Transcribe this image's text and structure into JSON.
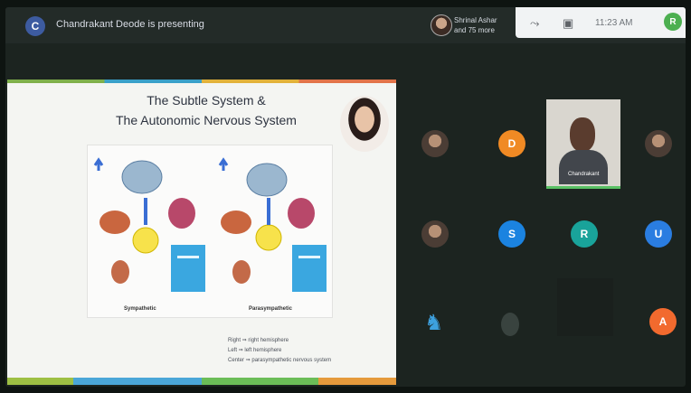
{
  "topbar": {
    "presenter_initial": "C",
    "presenting_text": "Chandrakant Deode is presenting",
    "people_line1": "Shrinal Ashar",
    "people_line2": "and 75 more"
  },
  "status": {
    "clock": "11:23 AM",
    "account_initial": "R"
  },
  "slide": {
    "title_line1": "The Subtle System &",
    "title_line2": "The Autonomic Nervous System",
    "caption_left": "Sympathetic",
    "caption_right": "Parasympathetic",
    "notes": [
      "Right ⇒ right hemisphere",
      "Left ⇒ left hemisphere",
      "Center ⇒ parasympathetic nervous system"
    ]
  },
  "participants": {
    "d": "D",
    "s": "S",
    "r": "R",
    "u": "U",
    "a": "A",
    "video_label": "Chandrakant"
  },
  "colors": {
    "d": "#f08a24",
    "s": "#1b83e0",
    "r": "#19a39a",
    "u": "#2a7de1",
    "a": "#f26a2e"
  }
}
